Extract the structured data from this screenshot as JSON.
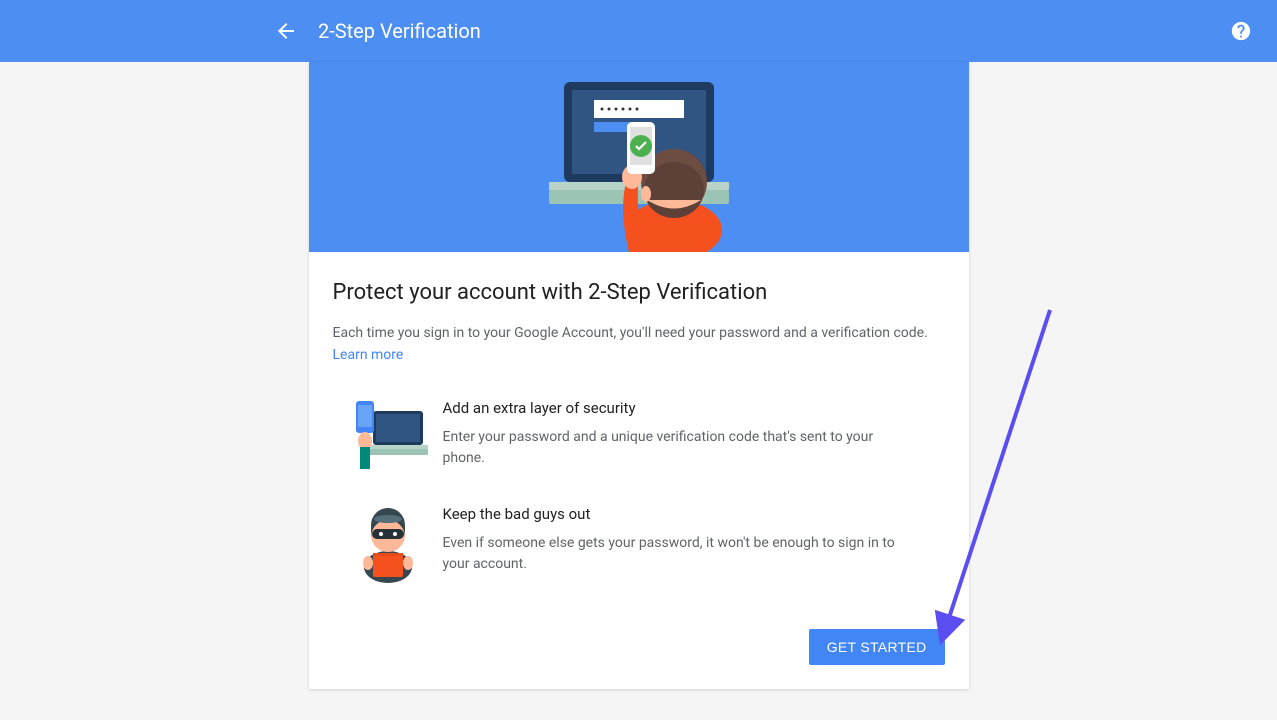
{
  "header": {
    "title": "2-Step Verification"
  },
  "card": {
    "subtitle": "Protect your account with 2-Step Verification",
    "description": "Each time you sign in to your Google Account, you'll need your password and a verification code.",
    "learn_more": "Learn more",
    "features": [
      {
        "title": "Add an extra layer of security",
        "desc": "Enter your password and a unique verification code that's sent to your phone."
      },
      {
        "title": "Keep the bad guys out",
        "desc": "Even if someone else gets your password, it won't be enough to sign in to your account."
      }
    ],
    "cta": "GET STARTED"
  }
}
